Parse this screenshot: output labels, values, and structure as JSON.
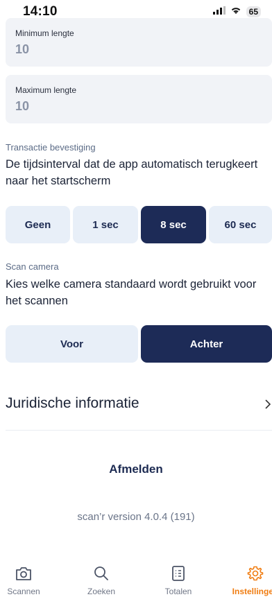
{
  "status_bar": {
    "time": "14:10",
    "battery": "65"
  },
  "fields": {
    "min": {
      "label": "Minimum lengte",
      "value": "10"
    },
    "max": {
      "label": "Maximum lengte",
      "value": "10"
    }
  },
  "transaction": {
    "label": "Transactie bevestiging",
    "description": "De tijdsinterval dat de app automatisch terugkeert naar het startscherm",
    "options": [
      "Geen",
      "1 sec",
      "8 sec",
      "60 sec"
    ],
    "selected": "8 sec"
  },
  "camera": {
    "label": "Scan camera",
    "description": "Kies welke camera standaard wordt gebruikt voor het scannen",
    "options": [
      "Voor",
      "Achter"
    ],
    "selected": "Achter"
  },
  "legal": {
    "title": "Juridische informatie"
  },
  "logout_label": "Afmelden",
  "version": "scan’r version 4.0.4 (191)",
  "tabs": [
    {
      "label": "Scannen",
      "icon": "camera-icon"
    },
    {
      "label": "Zoeken",
      "icon": "search-icon"
    },
    {
      "label": "Totalen",
      "icon": "list-icon"
    },
    {
      "label": "Instellingen",
      "icon": "gear-icon"
    }
  ],
  "active_tab": "Instellingen",
  "colors": {
    "primary": "#1d2b57",
    "accent": "#f07d12",
    "segment_bg": "#e8eff8"
  }
}
